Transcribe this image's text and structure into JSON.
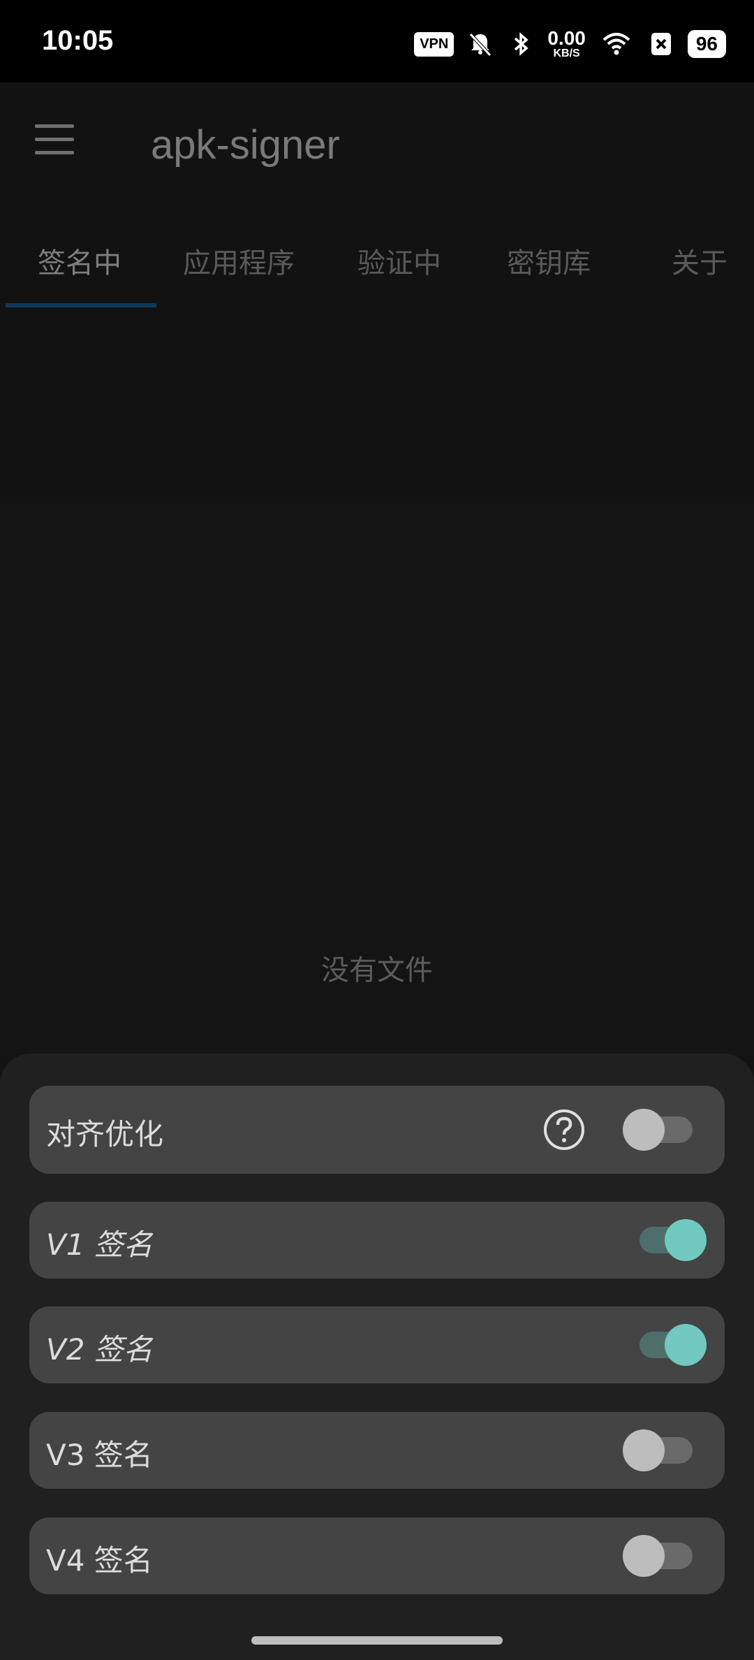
{
  "status_bar": {
    "time": "10:05",
    "vpn": "VPN",
    "speed_value": "0.00",
    "speed_unit": "KB/S",
    "battery": "96"
  },
  "app_bar": {
    "title": "apk-signer"
  },
  "tabs": [
    {
      "label": "签名中",
      "active": true
    },
    {
      "label": "应用程序"
    },
    {
      "label": "验证中"
    },
    {
      "label": "密钥库"
    },
    {
      "label": "关于"
    }
  ],
  "main": {
    "empty_text": "没有文件"
  },
  "options": [
    {
      "label": "对齐优化",
      "enabled": false,
      "has_help": true
    },
    {
      "label": "V1 签名",
      "enabled": true
    },
    {
      "label": "V2 签名",
      "enabled": true
    },
    {
      "label": "V3 签名",
      "enabled": false
    },
    {
      "label": "V4 签名",
      "enabled": false
    }
  ],
  "colors": {
    "switch_on": "#72c9bf",
    "tab_indicator": "#0d3a5a"
  }
}
